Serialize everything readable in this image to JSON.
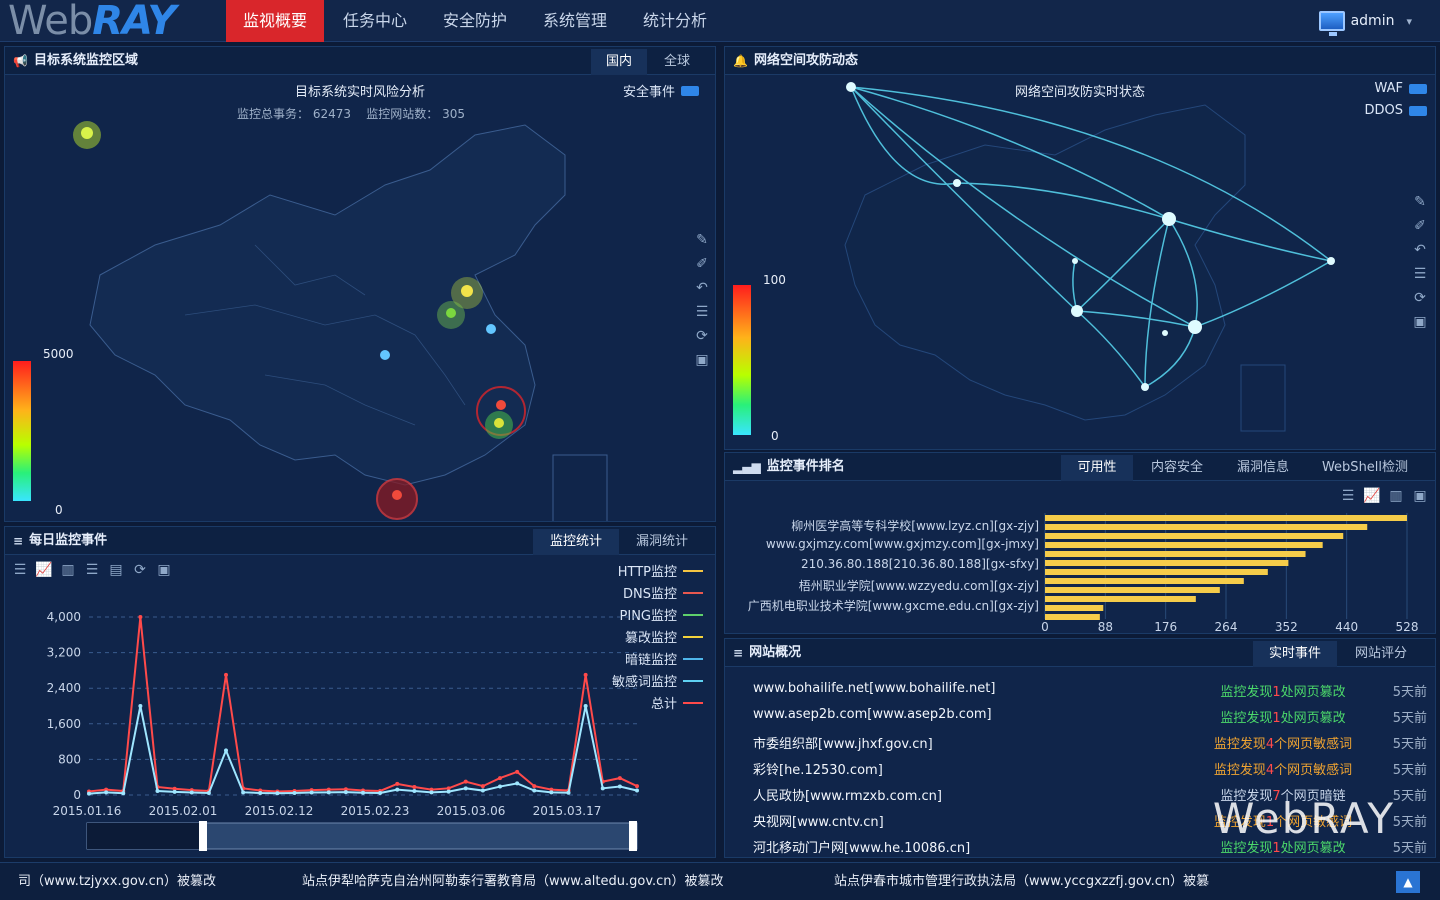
{
  "brand": {
    "logo_web": "Web",
    "logo_ray": "RAY"
  },
  "nav": {
    "items": [
      "监视概要",
      "任务中心",
      "安全防护",
      "系统管理",
      "统计分析"
    ],
    "active_index": 0,
    "user": "admin"
  },
  "target_panel": {
    "title": "目标系统监控区域",
    "tabs": [
      "国内",
      "全球"
    ],
    "active_tab": 0,
    "map_title": "目标系统实时风险分析",
    "summary_total_label": "监控总事务：",
    "summary_total_value": "62473",
    "summary_sites_label": "监控网站数：",
    "summary_sites_value": "305",
    "legend_label": "安全事件",
    "scale_max": "5000",
    "scale_min": "0"
  },
  "attack_panel": {
    "title": "网络空间攻防动态",
    "map_title": "网络空间攻防实时状态",
    "legend": [
      "WAF",
      "DDOS"
    ],
    "scale_max": "100",
    "scale_min": "0"
  },
  "daily_panel": {
    "title": "每日监控事件",
    "tabs": [
      "监控统计",
      "漏洞统计"
    ],
    "active_tab": 0,
    "legend": [
      {
        "name": "HTTP监控",
        "color": "#f5c542"
      },
      {
        "name": "DNS监控",
        "color": "#e8584f"
      },
      {
        "name": "PING监控",
        "color": "#5fd06b"
      },
      {
        "name": "篡改监控",
        "color": "#f3d23c"
      },
      {
        "name": "暗链监控",
        "color": "#4fb6ea"
      },
      {
        "name": "敏感词监控",
        "color": "#5fd1f2"
      },
      {
        "name": "总计",
        "color": "#ff4a4a"
      }
    ]
  },
  "chart_data": [
    {
      "type": "line",
      "yticks": [
        "4,000",
        "3,200",
        "2,400",
        "1,600",
        "800",
        "0"
      ],
      "xticks": [
        "2015.01.16",
        "2015.02.01",
        "2015.02.12",
        "2015.02.23",
        "2015.03.06",
        "2015.03.17"
      ],
      "ylim": [
        0,
        4000
      ],
      "series_total": [
        80,
        120,
        90,
        4000,
        180,
        140,
        110,
        90,
        2700,
        150,
        100,
        80,
        90,
        110,
        120,
        130,
        100,
        90,
        250,
        180,
        120,
        150,
        300,
        200,
        380,
        520,
        200,
        120,
        100,
        2700,
        300,
        380,
        200
      ],
      "series_http": [
        30,
        60,
        40,
        2000,
        90,
        70,
        55,
        45,
        1000,
        60,
        45,
        40,
        45,
        55,
        60,
        65,
        50,
        45,
        120,
        90,
        60,
        75,
        150,
        100,
        190,
        260,
        100,
        60,
        50,
        2000,
        150,
        190,
        100
      ]
    },
    {
      "type": "bar",
      "orientation": "horizontal",
      "categories": [
        "柳州医学高等专科学校[www.lzyz.cn][gx-zjy]",
        "www.gxjmzy.com[www.gxjmzy.com][gx-jmxy]",
        "210.36.80.188[210.36.80.188][gx-sfxy]",
        "梧州职业学院[www.wzzyedu.com][gx-zjy]",
        "广西机电职业技术学院[www.gxcme.edu.cn][gx-zjy]"
      ],
      "values": [
        528,
        470,
        435,
        405,
        380,
        355,
        325,
        290,
        255,
        220,
        85,
        80
      ],
      "xticks": [
        "0",
        "88",
        "176",
        "264",
        "352",
        "440",
        "528"
      ],
      "xlim": [
        0,
        528
      ],
      "color": "#f5cc4a"
    }
  ],
  "ranking_panel": {
    "title": "监控事件排名",
    "tabs": [
      "可用性",
      "内容安全",
      "漏洞信息",
      "WebShell检测"
    ],
    "active_tab": 0
  },
  "site_panel": {
    "title": "网站概况",
    "tabs": [
      "实时事件",
      "网站评分"
    ],
    "active_tab": 0,
    "rows": [
      {
        "site": "www.bohailife.net[www.bohailife.net]",
        "msg_pre": "监控发现",
        "count": "1",
        "msg_post": "处网页篡改",
        "color": "#4bd86a",
        "time": "5天前"
      },
      {
        "site": "www.asep2b.com[www.asep2b.com]",
        "msg_pre": "监控发现",
        "count": "1",
        "msg_post": "处网页篡改",
        "color": "#4bd86a",
        "time": "5天前"
      },
      {
        "site": "市委组织部[www.jhxf.gov.cn]",
        "msg_pre": "监控发现",
        "count": "4",
        "msg_post": "个网页敏感词",
        "color": "#f0a431",
        "time": "5天前"
      },
      {
        "site": "彩铃[he.12530.com]",
        "msg_pre": "监控发现",
        "count": "4",
        "msg_post": "个网页敏感词",
        "color": "#f0a431",
        "time": "5天前"
      },
      {
        "site": "人民政协[www.rmzxb.com.cn]",
        "msg_pre": "监控发现",
        "count": "7",
        "msg_post": "个网页暗链",
        "color": "#c9d6ea",
        "time": "5天前"
      },
      {
        "site": "央视网[www.cntv.cn]",
        "msg_pre": "监控发现",
        "count": "1",
        "msg_post": "个网页敏感词",
        "color": "#f0a431",
        "time": "5天前"
      },
      {
        "site": "河北移动门户网[www.he.10086.cn]",
        "msg_pre": "监控发现",
        "count": "1",
        "msg_post": "处网页篡改",
        "color": "#4bd86a",
        "time": "5天前"
      }
    ],
    "watermark": "WebRAY"
  },
  "ticker": [
    "司（www.tzjyxx.gov.cn）被篡改",
    "站点伊犁哈萨克自治州阿勒泰行署教育局（www.altedu.gov.cn）被篡改",
    "站点伊春市城市管理行政执法局（www.yccgxzzfj.gov.cn）被篡"
  ]
}
